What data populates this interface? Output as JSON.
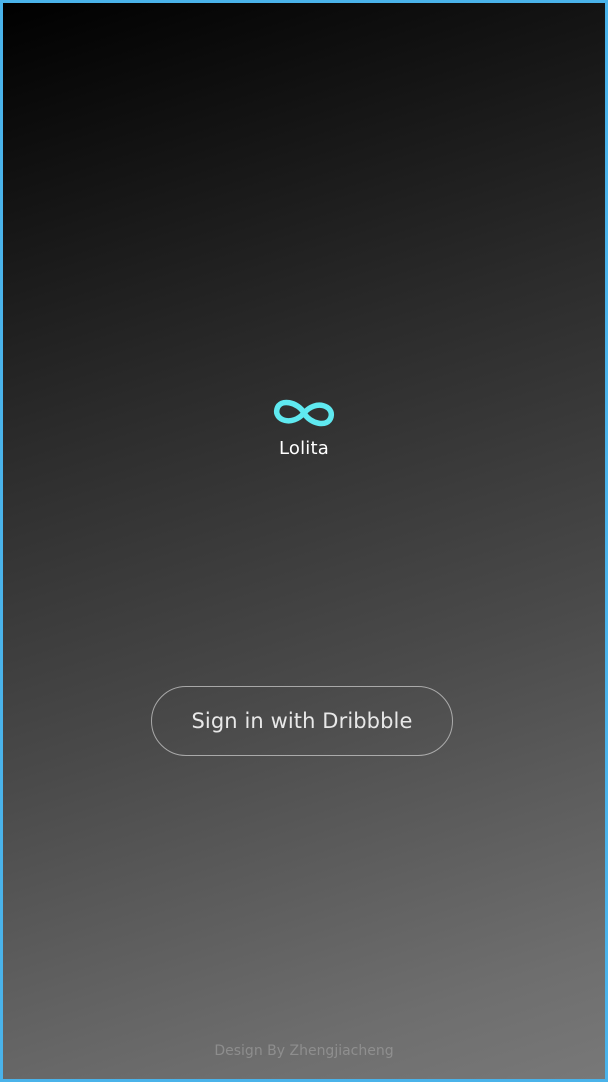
{
  "app": {
    "name": "Lolita",
    "logo_icon": "infinity-icon",
    "logo_color": "#5fe9f0"
  },
  "signin": {
    "label": "Sign in with Dribbble"
  },
  "footer": {
    "credit": "Design By Zhengjiacheng"
  },
  "colors": {
    "frame_border": "#4ab3ea",
    "gradient_start": "#000000",
    "gradient_end": "#787878"
  }
}
